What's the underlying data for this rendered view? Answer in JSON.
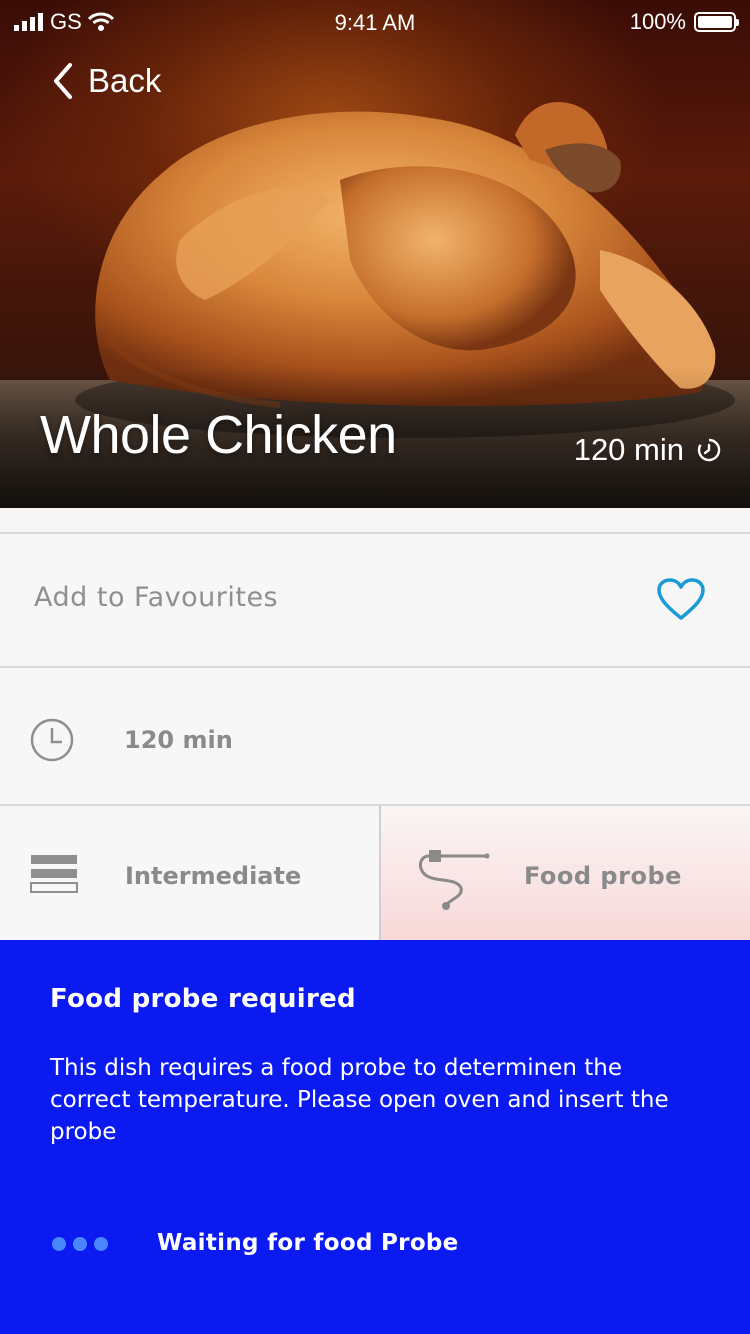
{
  "status_bar": {
    "carrier": "GS",
    "time": "9:41 AM",
    "battery": "100%",
    "battery_level": 1.0
  },
  "nav": {
    "back_label": "Back"
  },
  "recipe": {
    "title": "Whole Chicken",
    "duration": "120 min"
  },
  "favourites": {
    "label": "Add to Favourites",
    "heart_color": "#1a9ad6"
  },
  "details": {
    "duration_label": "120 min",
    "difficulty_label": "Intermediate",
    "probe_label": "Food probe"
  },
  "probe_notice": {
    "heading": "Food probe required",
    "body": "This dish requires a food probe to determinen the correct temperature. Please open oven and insert the probe",
    "waiting": "Waiting for food Probe",
    "background": "#0a1af0",
    "dot_color": "#4a86ff"
  },
  "icons": [
    "signal-icon",
    "wifi-icon",
    "battery-icon",
    "back-chevron-icon",
    "timer-icon",
    "heart-icon",
    "clock-icon",
    "difficulty-bars-icon",
    "food-probe-icon",
    "loading-dots-icon"
  ]
}
